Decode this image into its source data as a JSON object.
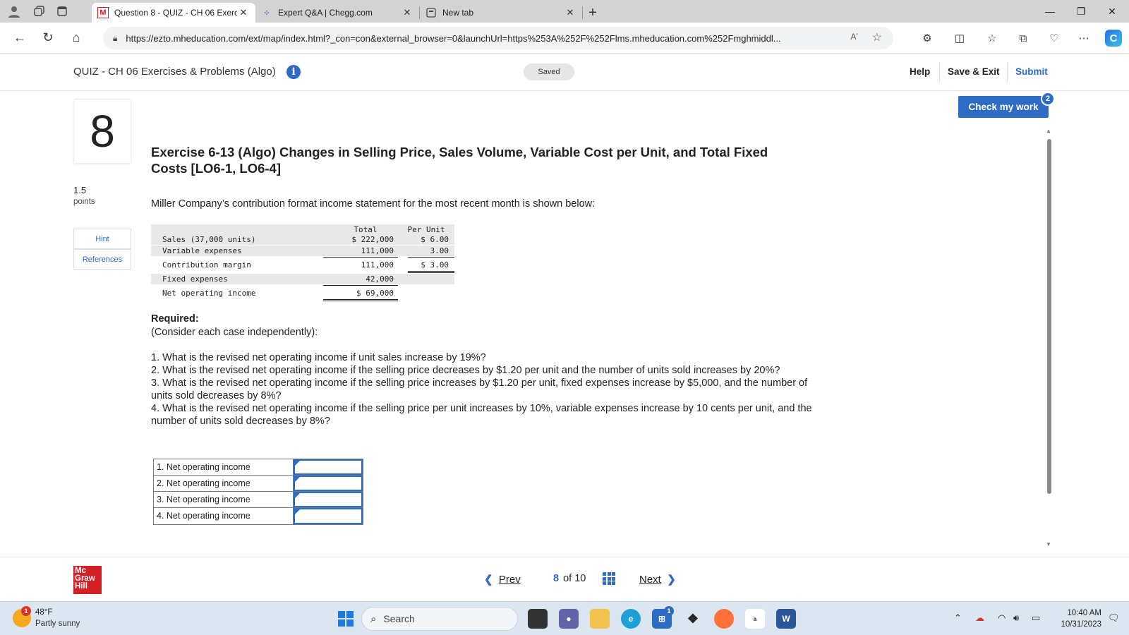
{
  "browser": {
    "tabs": [
      {
        "label": "Question 8 - QUIZ - CH 06 Exerci",
        "favicon": "M",
        "active": true
      },
      {
        "label": "Expert Q&A | Chegg.com",
        "favicon": "chegg-icon",
        "active": false
      },
      {
        "label": "New tab",
        "favicon": "newtab-icon",
        "active": false
      }
    ],
    "url": "https://ezto.mheducation.com/ext/map/index.html?_con=con&external_browser=0&launchUrl=https%253A%252F%252Flms.mheducation.com%252Fmghmiddl...",
    "read_aloud_glyph": "Aʼ"
  },
  "header": {
    "quiz_title": "QUIZ - CH 06 Exercises & Problems (Algo)",
    "saved_label": "Saved",
    "help_label": "Help",
    "save_exit_label": "Save & Exit",
    "submit_label": "Submit"
  },
  "question": {
    "number": "8",
    "points_value": "1.5",
    "points_label": "points",
    "hint_label": "Hint",
    "references_label": "References",
    "check_label": "Check my work",
    "check_count": "2",
    "title": "Exercise 6-13 (Algo) Changes in Selling Price, Sales Volume, Variable Cost per Unit, and Total Fixed Costs [LO6-1, LO6-4]",
    "intro": "Miller Company’s contribution format income statement for the most recent month is shown below:"
  },
  "income_statement": {
    "col_total": "Total",
    "col_per_unit": "Per Unit",
    "rows": [
      {
        "label": "Sales (37,000 units)",
        "total": "$ 222,000",
        "per_unit": "$ 6.00"
      },
      {
        "label": "Variable expenses",
        "total": "111,000",
        "per_unit": "3.00"
      },
      {
        "label": "Contribution margin",
        "total": "111,000",
        "per_unit": "$ 3.00"
      },
      {
        "label": "Fixed expenses",
        "total": "42,000",
        "per_unit": ""
      },
      {
        "label": "Net operating income",
        "total": "$ 69,000",
        "per_unit": ""
      }
    ]
  },
  "required": {
    "heading": "Required:",
    "subheading": "(Consider each case independently):",
    "items": [
      "1. What is the revised net operating income if unit sales increase by 19%?",
      "2. What is the revised net operating income if the selling price decreases by $1.20 per unit and the number of units sold increases by 20%?",
      "3. What is the revised net operating income if the selling price increases by $1.20 per unit, fixed expenses increase by $5,000, and the number of units sold decreases by 8%?",
      "4. What is the revised net operating income if the selling price per unit increases by 10%, variable expenses increase by 10 cents per unit, and the number of units sold decreases by 8%?"
    ]
  },
  "answers": [
    {
      "label": "1. Net operating income",
      "value": ""
    },
    {
      "label": "2. Net operating income",
      "value": ""
    },
    {
      "label": "3. Net operating income",
      "value": ""
    },
    {
      "label": "4. Net operating income",
      "value": ""
    }
  ],
  "footer": {
    "logo_lines": [
      "Mc",
      "Graw",
      "Hill"
    ],
    "prev_label": "Prev",
    "current": "8",
    "of_label": "of 10",
    "next_label": "Next"
  },
  "taskbar": {
    "weather_badge": "1",
    "temperature": "48°F",
    "weather_desc": "Partly sunny",
    "search_placeholder": "Search",
    "store_badge": "1",
    "time": "10:40 AM",
    "date": "10/31/2023"
  },
  "colors": {
    "accent": "#2d6bc4",
    "brand_red": "#d32027",
    "taskbar": "#dce6f0"
  }
}
